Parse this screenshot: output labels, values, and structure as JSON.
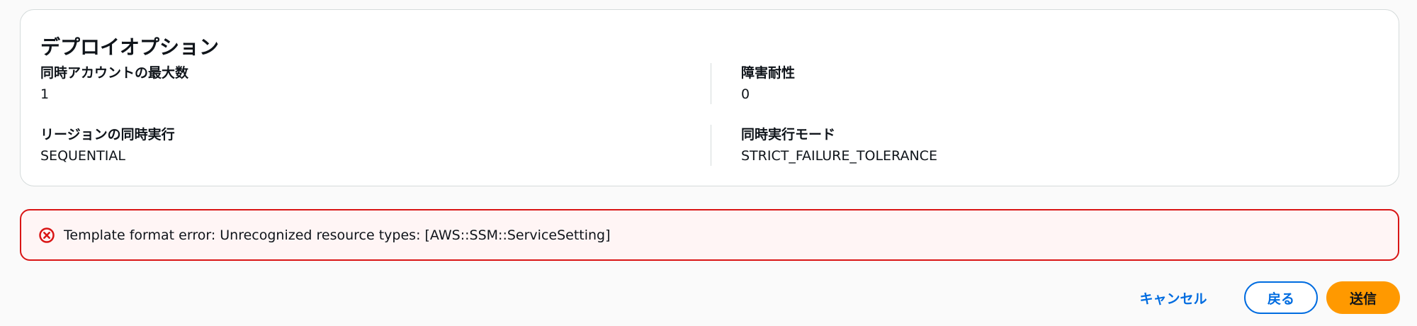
{
  "deploy_options": {
    "title": "デプロイオプション",
    "max_concurrent_accounts": {
      "label": "同時アカウントの最大数",
      "value": "1"
    },
    "failure_tolerance": {
      "label": "障害耐性",
      "value": "0"
    },
    "region_concurrency": {
      "label": "リージョンの同時実行",
      "value": "SEQUENTIAL"
    },
    "concurrency_mode": {
      "label": "同時実行モード",
      "value": "STRICT_FAILURE_TOLERANCE"
    }
  },
  "error_alert": {
    "icon": "error-x-circle-icon",
    "message": "Template format error: Unrecognized resource types: [AWS::SSM::ServiceSetting]"
  },
  "footer": {
    "cancel_label": "キャンセル",
    "back_label": "戻る",
    "submit_label": "送信"
  },
  "colors": {
    "background": "#fafafa",
    "card_border": "#d5dbdb",
    "error_border": "#d91515",
    "error_background": "#fff5f5",
    "link_blue": "#006ce0",
    "primary_orange": "#ff9900",
    "text": "#0f141a"
  }
}
